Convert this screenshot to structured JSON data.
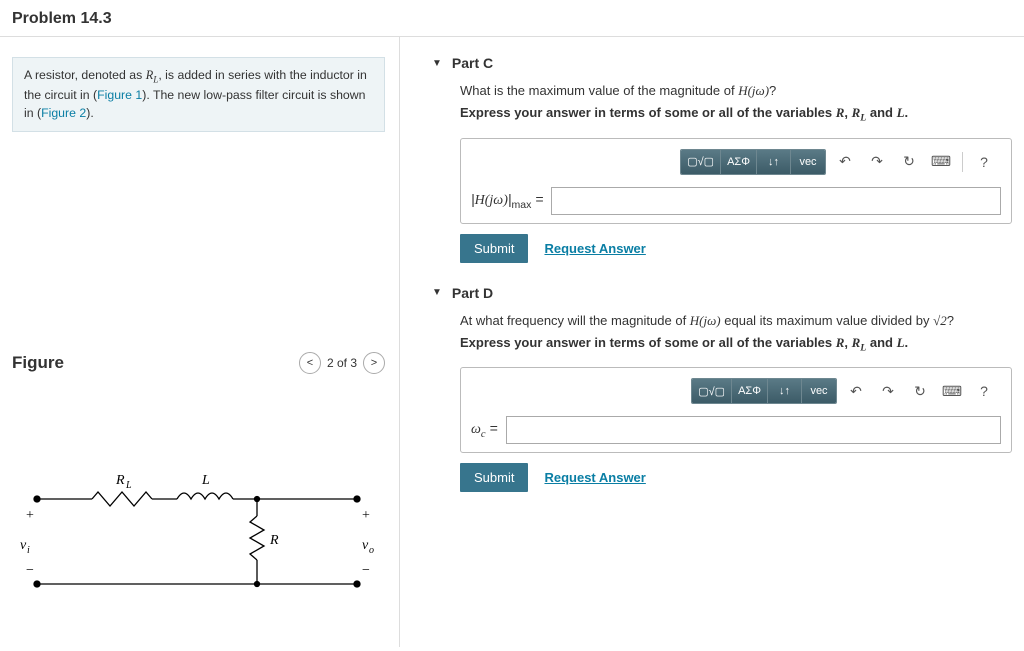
{
  "header": {
    "title": "Problem 14.3"
  },
  "intro": {
    "text_before_RL": "A resistor, denoted as ",
    "RL": "R_L",
    "text_mid": ", is added in series with the inductor in the circuit in (",
    "fig1": "Figure 1",
    "text_mid2": "). The new low-pass filter circuit is shown in (",
    "fig2": "Figure 2",
    "text_after": ")."
  },
  "figure": {
    "label": "Figure",
    "nav_prev": "<",
    "counter": "2 of 3",
    "nav_next": ">",
    "sym_RL": "R_L",
    "sym_L": "L",
    "sym_R": "R",
    "sym_vi": "v_i",
    "sym_vo": "v_o"
  },
  "toolbar": {
    "templates": "▢√▢",
    "greek": "ΑΣΦ",
    "subsup": "↓↑",
    "vec": "vec",
    "undo": "↶",
    "redo": "↷",
    "reset": "↻",
    "kbd": "⌨",
    "help": "?"
  },
  "partC": {
    "title": "Part C",
    "question": "What is the maximum value of the magnitude of H(jω)?",
    "instruction": "Express your answer in terms of some or all of the variables R, R_L and L.",
    "answer_label": "|H(jω)|_max =",
    "submit": "Submit",
    "request": "Request Answer"
  },
  "partD": {
    "title": "Part D",
    "question": "At what frequency will the magnitude of H(jω) equal its maximum value divided by √2?",
    "instruction": "Express your answer in terms of some or all of the variables R, R_L and L.",
    "answer_label": "ω_c =",
    "submit": "Submit",
    "request": "Request Answer"
  }
}
